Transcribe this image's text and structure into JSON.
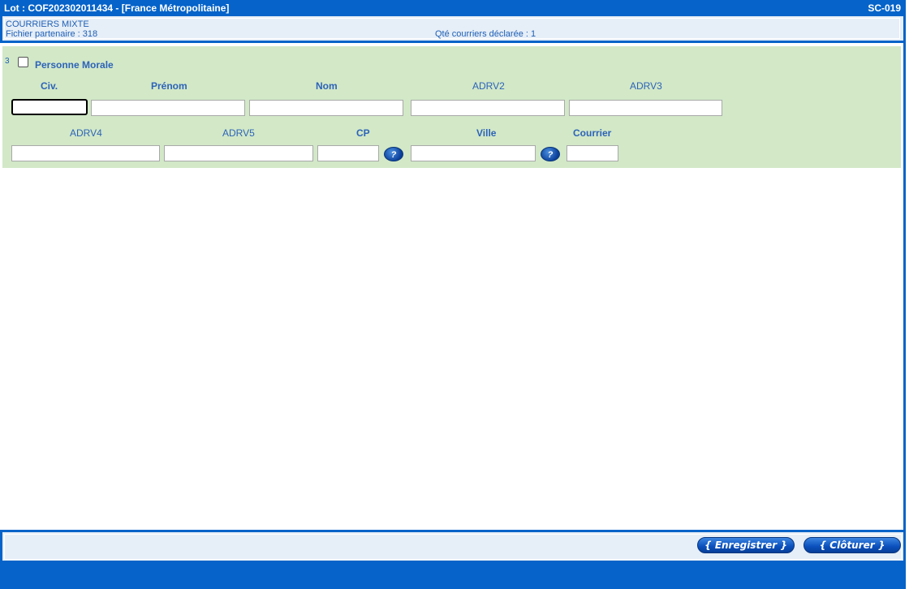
{
  "window": {
    "title": "Lot : COF202302011434 - [France Métropolitaine]",
    "screen_code": "SC-019"
  },
  "info": {
    "mail_type": "COURRIERS MIXTE",
    "partner_file": "Fichier partenaire : 318",
    "declared_qty": "Qté courriers déclarée : 1"
  },
  "form": {
    "row_number": "3",
    "personne_morale_label": "Personne Morale",
    "personne_morale_checked": false,
    "labels": {
      "civ": "Civ.",
      "prenom": "Prénom",
      "nom": "Nom",
      "adrv2": "ADRV2",
      "adrv3": "ADRV3",
      "adrv4": "ADRV4",
      "adrv5": "ADRV5",
      "cp": "CP",
      "ville": "Ville",
      "courrier": "Courrier"
    },
    "values": {
      "civ": "",
      "prenom": "",
      "nom": "",
      "adrv2": "",
      "adrv3": "",
      "adrv4": "",
      "adrv5": "",
      "cp": "",
      "ville": "",
      "courrier": ""
    },
    "help_glyph": "?"
  },
  "footer": {
    "save_label": "{ Enregistrer }",
    "close_label": "{  Clôturer  }"
  },
  "colors": {
    "accent_blue": "#0563c9",
    "panel_green": "#d2e8c7",
    "label_blue": "#2d63b8",
    "info_bg": "#e6eef7"
  }
}
